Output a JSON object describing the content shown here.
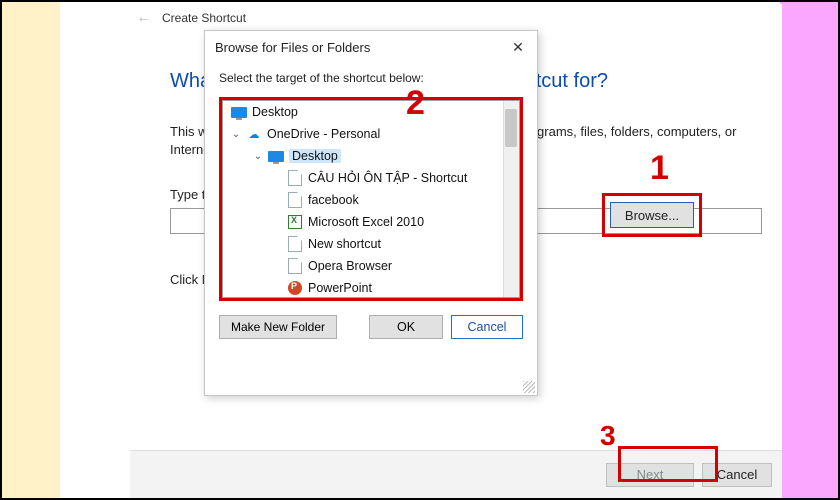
{
  "annotations": {
    "n1": "1",
    "n2": "2",
    "n3": "3"
  },
  "wizard": {
    "title": "Create Shortcut",
    "heading": "What item would you like to create a shortcut for?",
    "para": "This wizard helps you to create shortcuts to local or network programs, files, folders, computers, or Internet addresses.",
    "label": "Type the location of the item:",
    "browse": "Browse...",
    "click_next": "Click Next to continue.",
    "next": "Next",
    "cancel": "Cancel"
  },
  "dialog": {
    "title": "Browse for Files or Folders",
    "prompt": "Select the target of the shortcut below:",
    "make_folder": "Make New Folder",
    "ok": "OK",
    "cancel": "Cancel",
    "tree": {
      "root": "Desktop",
      "onedrive": "OneDrive - Personal",
      "desktop2": "Desktop",
      "items": [
        "CÂU HỎI ÔN TẬP - Shortcut",
        "facebook",
        "Microsoft Excel 2010",
        "New shortcut",
        "Opera Browser",
        "PowerPoint"
      ]
    }
  }
}
